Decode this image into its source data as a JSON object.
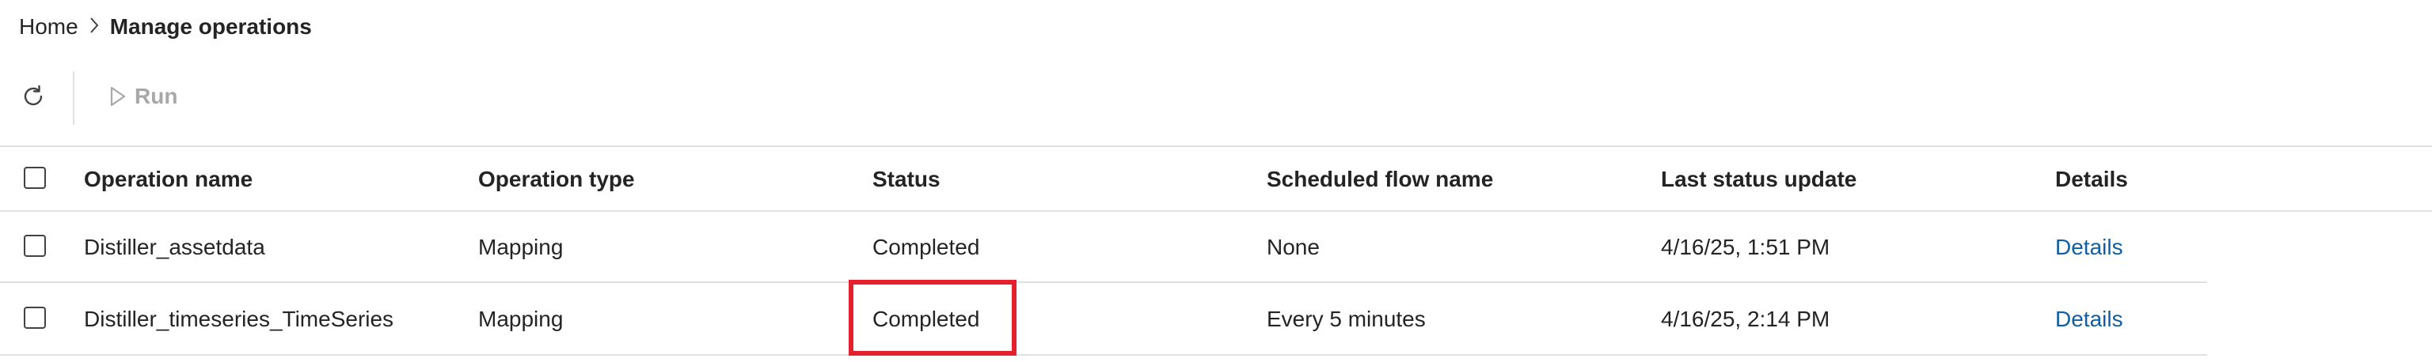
{
  "breadcrumb": {
    "home": "Home",
    "current": "Manage operations"
  },
  "toolbar": {
    "refresh_icon": "refresh-icon",
    "run_label": "Run",
    "run_icon": "play-icon"
  },
  "table": {
    "columns": {
      "name": "Operation name",
      "type": "Operation type",
      "status": "Status",
      "flow": "Scheduled flow name",
      "update": "Last status update",
      "details": "Details"
    },
    "rows": [
      {
        "name": "Distiller_assetdata",
        "type": "Mapping",
        "status": "Completed",
        "flow": "None",
        "update": "4/16/25, 1:51 PM",
        "details": "Details"
      },
      {
        "name": "Distiller_timeseries_TimeSeries",
        "type": "Mapping",
        "status": "Completed",
        "flow": "Every 5 minutes",
        "update": "4/16/25, 2:14 PM",
        "details": "Details"
      }
    ]
  },
  "colors": {
    "link": "#115ea3",
    "highlight": "#e3202b",
    "disabled": "#a8a8a8",
    "divider": "#e0e0e0"
  }
}
